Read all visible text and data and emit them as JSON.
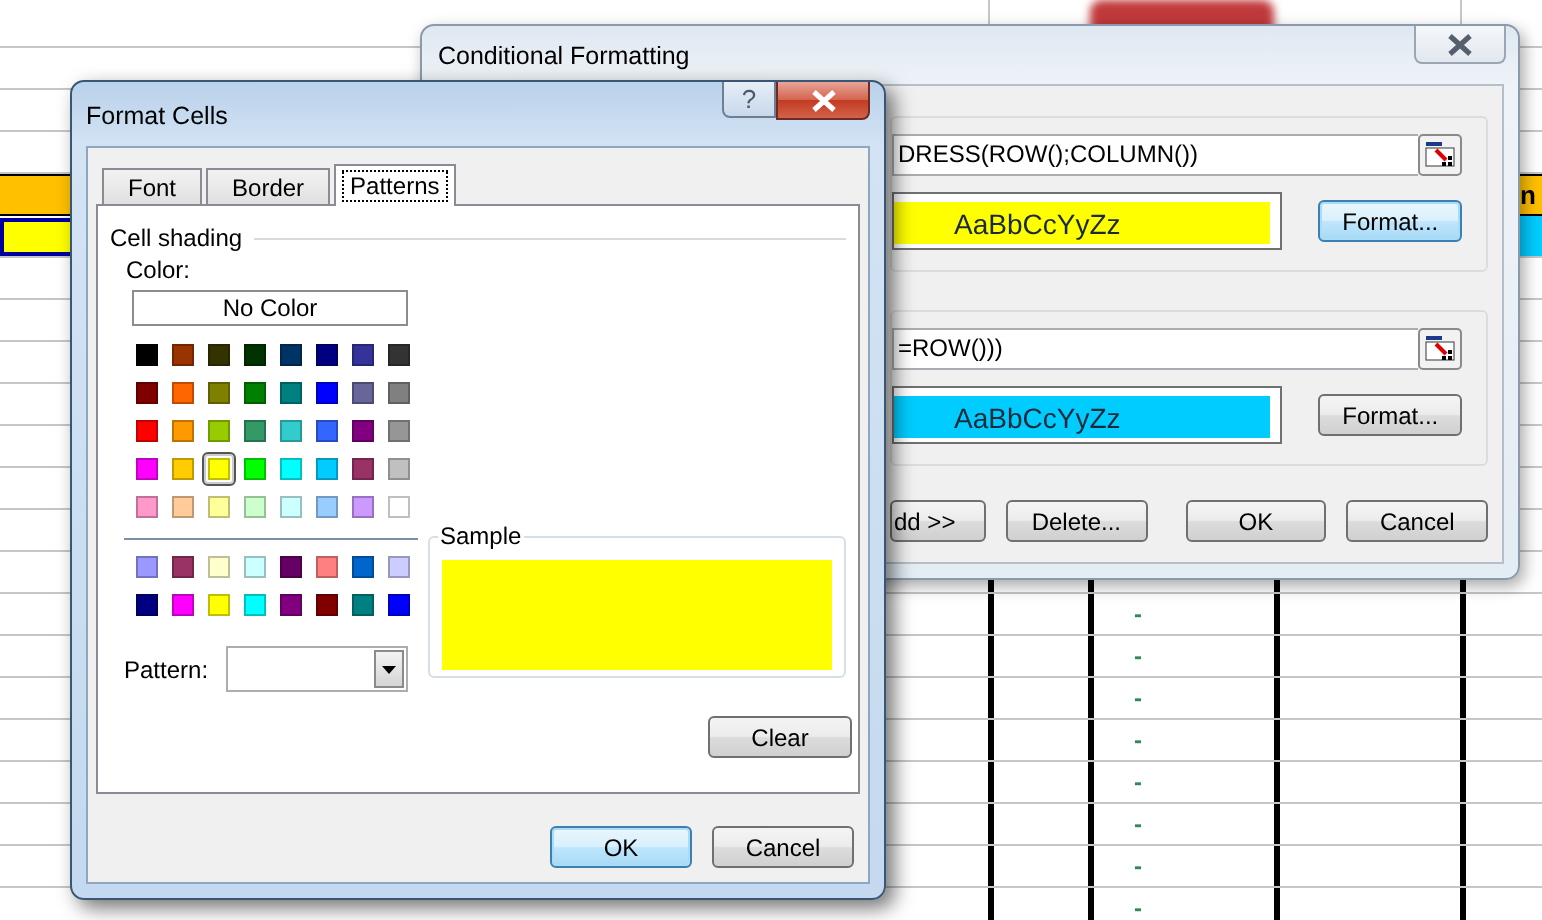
{
  "spreadsheet": {
    "header_cell": "n",
    "cells": [
      "-",
      "-",
      "-",
      "-",
      "-",
      "-",
      "-",
      "-"
    ]
  },
  "conditional_formatting": {
    "title": "Conditional Formatting",
    "conditions": [
      {
        "formula": "DRESS(ROW();COLUMN())",
        "preview": "AaBbCcYyZz",
        "color": "#ffff00",
        "format_button": "Format...",
        "focused": true
      },
      {
        "formula": "=ROW()))",
        "preview": "AaBbCcYyZz",
        "color": "#00ccff",
        "format_button": "Format...",
        "focused": false
      }
    ],
    "buttons": [
      "dd >>",
      "Delete...",
      "OK",
      "Cancel"
    ]
  },
  "format_cells": {
    "title": "Format Cells",
    "help_button": "?",
    "tabs": [
      {
        "label": "Font",
        "selected": false
      },
      {
        "label": "Border",
        "selected": false
      },
      {
        "label": "Patterns",
        "selected": true
      }
    ],
    "section": "Cell shading",
    "color_label": "Color:",
    "no_color_button": "No Color",
    "palette": [
      {
        "color": "#000000",
        "selected": false
      },
      {
        "color": "#993300",
        "selected": false
      },
      {
        "color": "#333300",
        "selected": false
      },
      {
        "color": "#003300",
        "selected": false
      },
      {
        "color": "#003366",
        "selected": false
      },
      {
        "color": "#000080",
        "selected": false
      },
      {
        "color": "#333399",
        "selected": false
      },
      {
        "color": "#333333",
        "selected": false
      },
      {
        "color": "#800000",
        "selected": false
      },
      {
        "color": "#ff6600",
        "selected": false
      },
      {
        "color": "#808000",
        "selected": false
      },
      {
        "color": "#008000",
        "selected": false
      },
      {
        "color": "#008080",
        "selected": false
      },
      {
        "color": "#0000ff",
        "selected": false
      },
      {
        "color": "#666699",
        "selected": false
      },
      {
        "color": "#808080",
        "selected": false
      },
      {
        "color": "#ff0000",
        "selected": false
      },
      {
        "color": "#ff9900",
        "selected": false
      },
      {
        "color": "#99cc00",
        "selected": false
      },
      {
        "color": "#339966",
        "selected": false
      },
      {
        "color": "#33cccc",
        "selected": false
      },
      {
        "color": "#3366ff",
        "selected": false
      },
      {
        "color": "#800080",
        "selected": false
      },
      {
        "color": "#969696",
        "selected": false
      },
      {
        "color": "#ff00ff",
        "selected": false
      },
      {
        "color": "#ffcc00",
        "selected": false
      },
      {
        "color": "#ffff00",
        "selected": true
      },
      {
        "color": "#00ff00",
        "selected": false
      },
      {
        "color": "#00ffff",
        "selected": false
      },
      {
        "color": "#00ccff",
        "selected": false
      },
      {
        "color": "#993366",
        "selected": false
      },
      {
        "color": "#c0c0c0",
        "selected": false
      },
      {
        "color": "#ff99cc",
        "selected": false
      },
      {
        "color": "#ffcc99",
        "selected": false
      },
      {
        "color": "#ffff99",
        "selected": false
      },
      {
        "color": "#ccffcc",
        "selected": false
      },
      {
        "color": "#ccffff",
        "selected": false
      },
      {
        "color": "#99ccff",
        "selected": false
      },
      {
        "color": "#cc99ff",
        "selected": false
      },
      {
        "color": "#ffffff",
        "selected": false
      }
    ],
    "extra_palette": [
      {
        "color": "#9999ff",
        "selected": false
      },
      {
        "color": "#993366",
        "selected": false
      },
      {
        "color": "#ffffcc",
        "selected": false
      },
      {
        "color": "#ccffff",
        "selected": false
      },
      {
        "color": "#660066",
        "selected": false
      },
      {
        "color": "#ff8080",
        "selected": false
      },
      {
        "color": "#0066cc",
        "selected": false
      },
      {
        "color": "#ccccff",
        "selected": false
      },
      {
        "color": "#000080",
        "selected": false
      },
      {
        "color": "#ff00ff",
        "selected": false
      },
      {
        "color": "#ffff00",
        "selected": false
      },
      {
        "color": "#00ffff",
        "selected": false
      },
      {
        "color": "#800080",
        "selected": false
      },
      {
        "color": "#800000",
        "selected": false
      },
      {
        "color": "#008080",
        "selected": false
      },
      {
        "color": "#0000ff",
        "selected": false
      }
    ],
    "pattern_label": "Pattern:",
    "sample_label": "Sample",
    "clear_button": "Clear",
    "buttons": [
      {
        "label": "OK",
        "default": true
      },
      {
        "label": "Cancel",
        "default": false
      }
    ]
  }
}
